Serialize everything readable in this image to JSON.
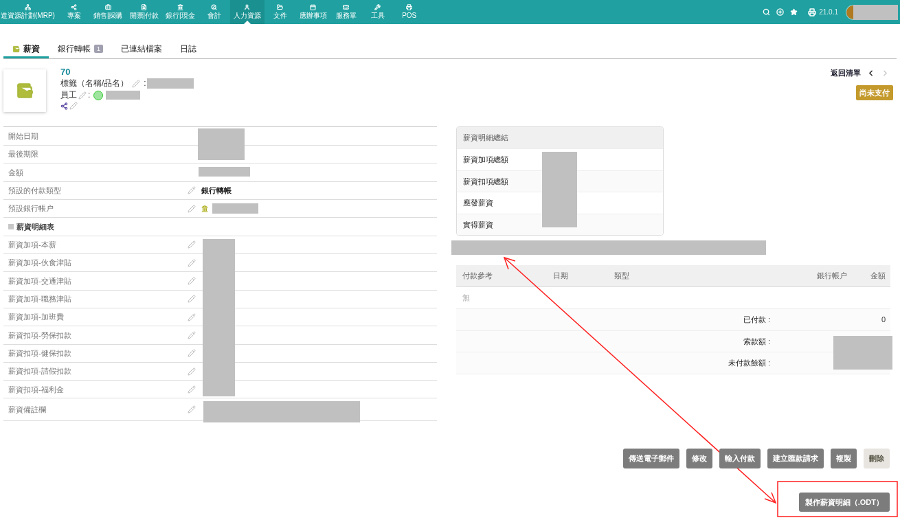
{
  "nav": {
    "items": [
      {
        "label": "造資源計劃(MRP)",
        "selected": false
      },
      {
        "label": "專案",
        "selected": false
      },
      {
        "label": "銷售|採購",
        "selected": false
      },
      {
        "label": "開票|付款",
        "selected": false
      },
      {
        "label": "銀行|現金",
        "selected": false
      },
      {
        "label": "會計",
        "selected": false
      },
      {
        "label": "人力資源",
        "selected": true
      },
      {
        "label": "文件",
        "selected": false
      },
      {
        "label": "應辦事項",
        "selected": false
      },
      {
        "label": "服務單",
        "selected": false
      },
      {
        "label": "工具",
        "selected": false
      },
      {
        "label": "POS",
        "selected": false
      }
    ],
    "version": "21.0.1"
  },
  "tabs": [
    {
      "label": "薪資",
      "selected": true
    },
    {
      "label": "銀行轉帳",
      "badge": "1",
      "selected": false
    },
    {
      "label": "已連結檔案",
      "selected": false
    },
    {
      "label": "日誌",
      "selected": false
    }
  ],
  "header": {
    "ref": "70",
    "label_field": "標籤（名稱/品名）",
    "label_colon": ":",
    "employee_field": "員工",
    "employee_colon": ":",
    "back_link": "返回清單",
    "status": "尚未支付"
  },
  "fields": [
    {
      "kind": "plain",
      "label": "開始日期"
    },
    {
      "kind": "plain",
      "label": "最後期限"
    },
    {
      "kind": "plain",
      "label": "金額"
    },
    {
      "kind": "edit",
      "label": "預設的付款類型",
      "value": "銀行轉帳"
    },
    {
      "kind": "bank",
      "label": "預設銀行帳户"
    },
    {
      "kind": "section",
      "label": "薪資明細表"
    },
    {
      "kind": "edit",
      "label": "薪資加項-本薪"
    },
    {
      "kind": "edit",
      "label": "薪資加項-伙食津貼"
    },
    {
      "kind": "edit",
      "label": "薪資加項-交通津貼"
    },
    {
      "kind": "edit",
      "label": "薪資加項-職務津貼"
    },
    {
      "kind": "edit",
      "label": "薪資加項-加班費"
    },
    {
      "kind": "edit",
      "label": "薪資扣項-勞保扣款"
    },
    {
      "kind": "edit",
      "label": "薪資扣項-健保扣款"
    },
    {
      "kind": "edit",
      "label": "薪資扣項-請假扣款"
    },
    {
      "kind": "edit",
      "label": "薪資扣項-福利金"
    },
    {
      "kind": "edit",
      "label": "薪資備註欄"
    }
  ],
  "summary": {
    "title": "薪資明細總結",
    "rows": [
      "薪資加項總額",
      "薪資扣項總額",
      "應發薪資",
      "實得薪資"
    ]
  },
  "payments": {
    "columns": [
      "付款參考",
      "日期",
      "類型",
      "銀行帳户",
      "金額"
    ],
    "empty": "無",
    "totals": [
      {
        "label": "已付款 :",
        "value": "0"
      },
      {
        "label": "索款額 :"
      },
      {
        "label": "未付款餘額 :"
      }
    ]
  },
  "actions": [
    {
      "label": "傳送電子郵件",
      "disabled": false
    },
    {
      "label": "修改",
      "disabled": false
    },
    {
      "label": "輸入付款",
      "disabled": false
    },
    {
      "label": "建立匯款請求",
      "disabled": false
    },
    {
      "label": "複製",
      "disabled": false
    },
    {
      "label": "刪除",
      "disabled": true
    }
  ],
  "extra_action": "製作薪資明細（.ODT）"
}
